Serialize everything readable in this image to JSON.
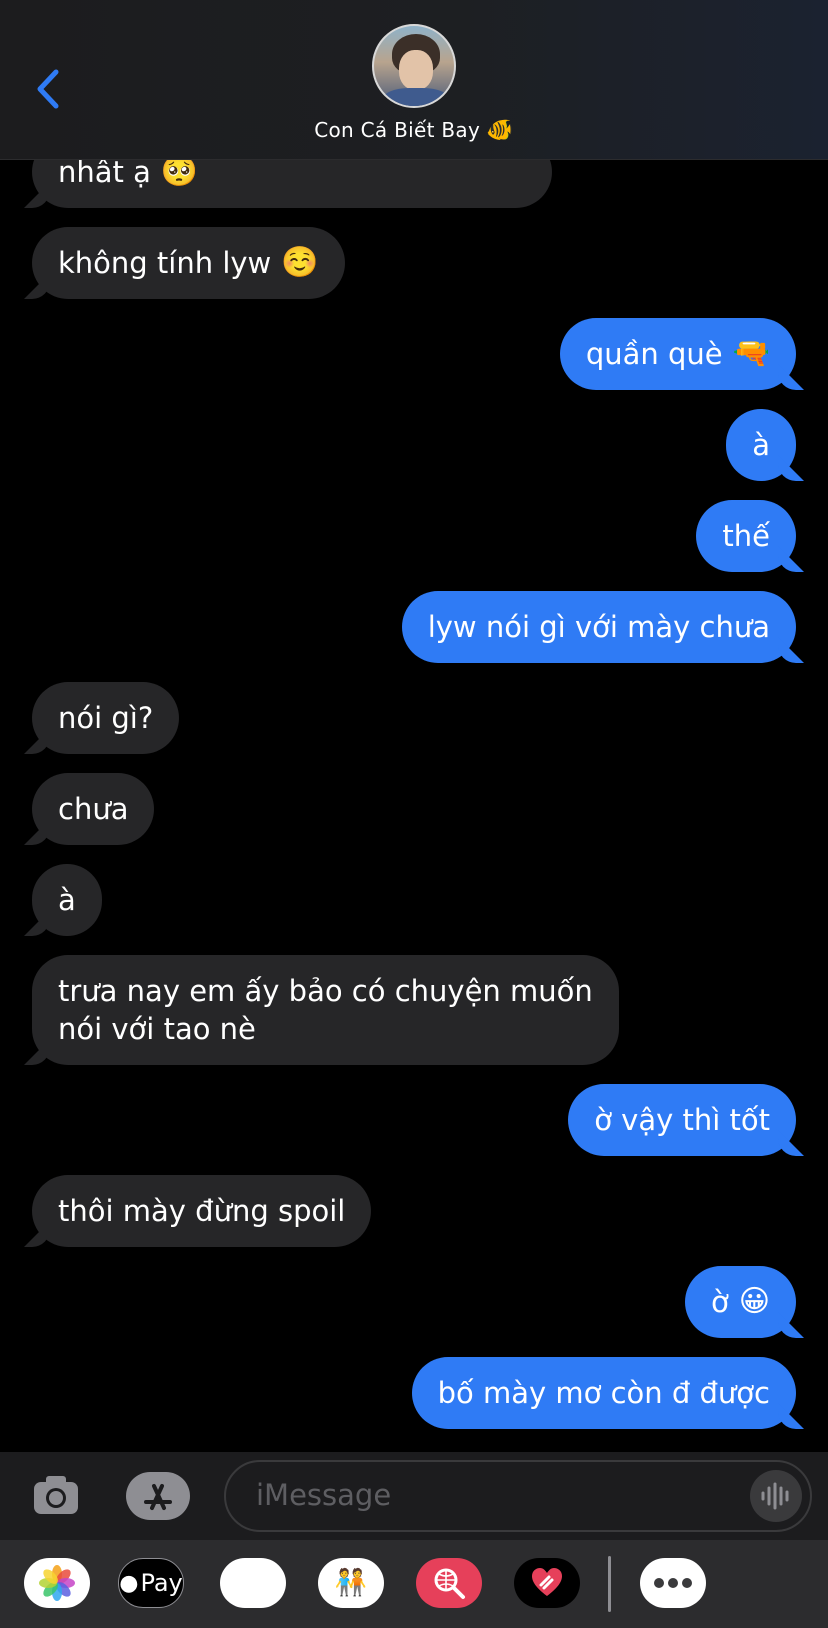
{
  "header": {
    "contact_name": "Con Cá Biết Bay",
    "contact_emoji": "🐠",
    "back_icon": "chevron-left-icon",
    "accent_color": "#2f7bf5"
  },
  "messages": [
    {
      "from": "them",
      "text": "nhât ạ",
      "emoji": "🥺"
    },
    {
      "from": "them",
      "text": "không tính lyw",
      "emoji": "☺️"
    },
    {
      "from": "me",
      "text": "quần què",
      "emoji": "🔫"
    },
    {
      "from": "me",
      "text": "à"
    },
    {
      "from": "me",
      "text": "thế"
    },
    {
      "from": "me",
      "text": "lyw nói gì với mày chưa"
    },
    {
      "from": "them",
      "text": "nói gì?"
    },
    {
      "from": "them",
      "text": "chưa"
    },
    {
      "from": "them",
      "text": "à"
    },
    {
      "from": "them",
      "lines": [
        "trưa nay em ấy bảo có chuyện muốn",
        "nói với tao nè"
      ]
    },
    {
      "from": "me",
      "text": "ờ vậy thì tốt"
    },
    {
      "from": "them",
      "text": "thôi mày đừng spoil"
    },
    {
      "from": "me",
      "text": "ờ",
      "emoji": "😀"
    },
    {
      "from": "me",
      "text": "bố mày mơ còn đ được"
    }
  ],
  "input": {
    "placeholder": "iMessage",
    "camera_icon": "camera-icon",
    "apps_icon": "app-store-icon",
    "audio_icon": "waveform-icon"
  },
  "drawer": {
    "apps": [
      {
        "name": "photos-icon"
      },
      {
        "name": "apple-pay-icon",
        "label": "Pay"
      },
      {
        "name": "animoji-icon",
        "glyph": "🐵"
      },
      {
        "name": "memoji-icon",
        "glyph": "🧑‍🤝‍🧑"
      },
      {
        "name": "web-search-icon"
      },
      {
        "name": "digital-touch-icon"
      },
      {
        "name": "more-icon"
      }
    ]
  }
}
